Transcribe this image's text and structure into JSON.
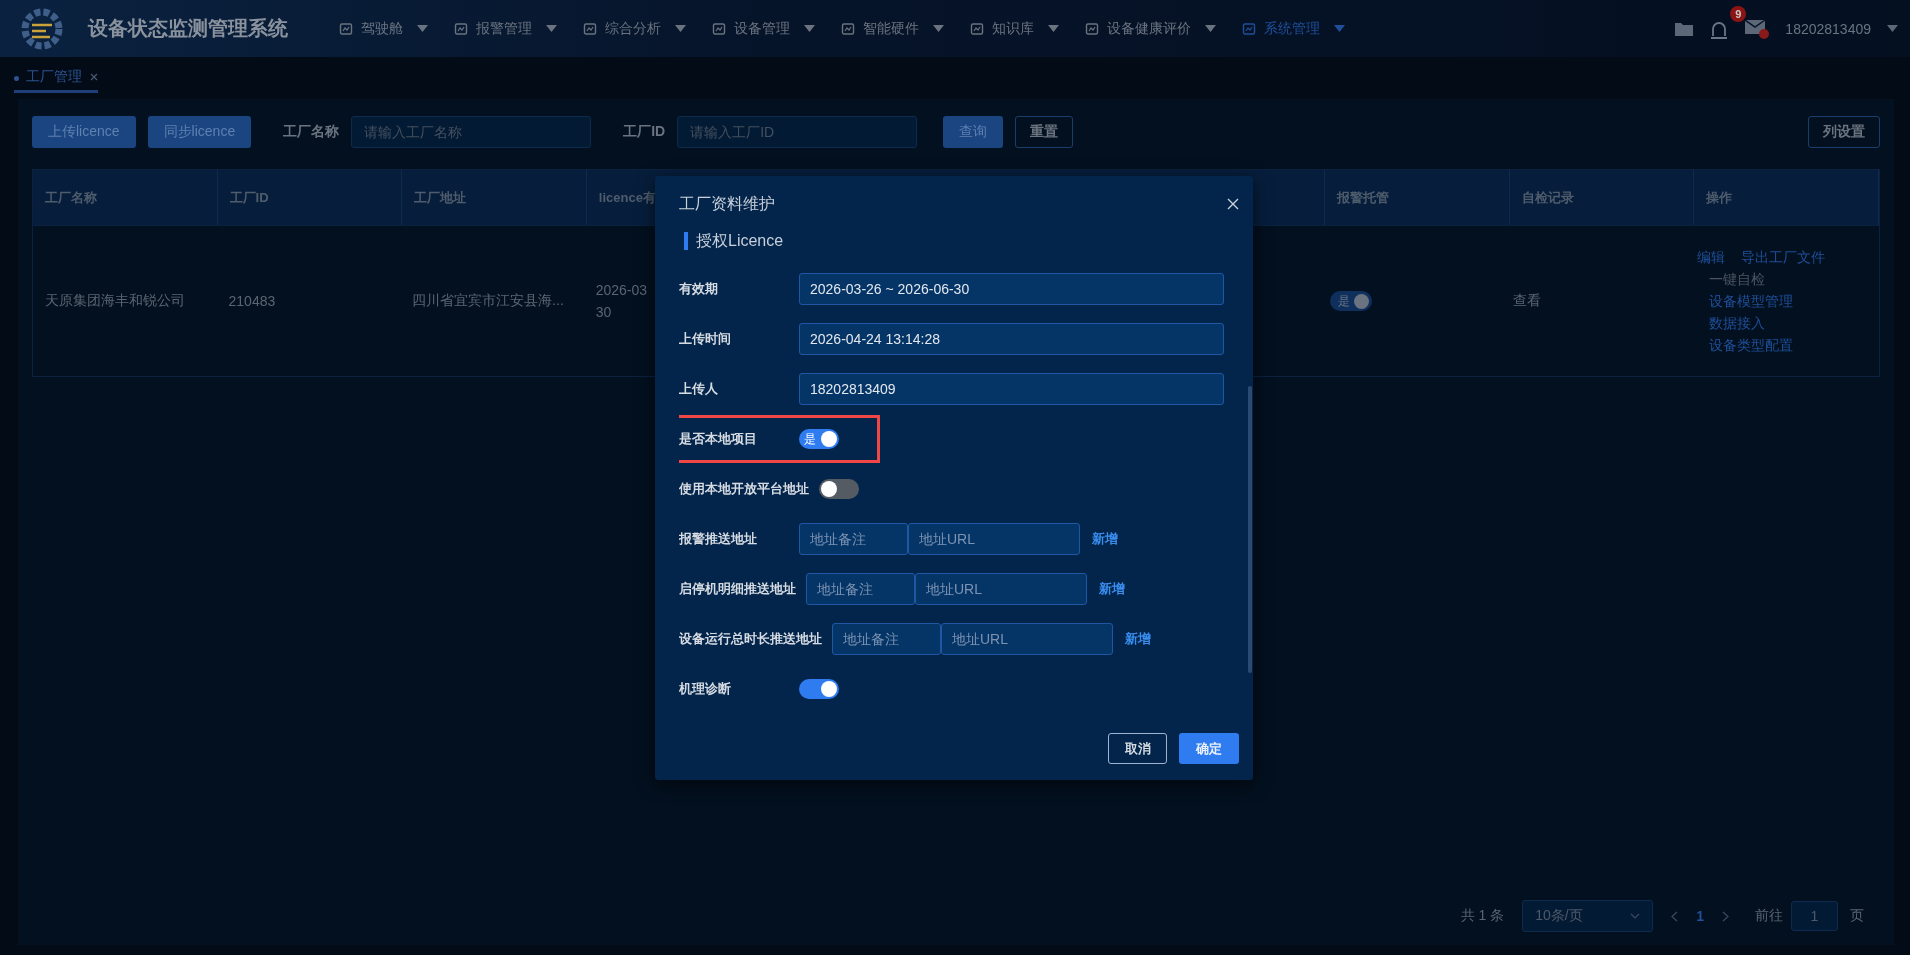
{
  "header": {
    "title": "设备状态监测管理系统",
    "nav": [
      {
        "label": "驾驶舱",
        "selected": false
      },
      {
        "label": "报警管理",
        "selected": false
      },
      {
        "label": "综合分析",
        "selected": false
      },
      {
        "label": "设备管理",
        "selected": false
      },
      {
        "label": "智能硬件",
        "selected": false
      },
      {
        "label": "知识库",
        "selected": false
      },
      {
        "label": "设备健康评价",
        "selected": false
      },
      {
        "label": "系统管理",
        "selected": true
      }
    ],
    "alarm_count": "9",
    "user": "18202813409"
  },
  "tabs": [
    {
      "label": "工厂管理",
      "selected": true
    }
  ],
  "toolbar": {
    "buttons": [
      "上传licence",
      "同步licence"
    ],
    "filters": [
      {
        "label": "工厂名称",
        "placeholder": "请输入工厂名称"
      },
      {
        "label": "工厂ID",
        "placeholder": "请输入工厂ID"
      }
    ],
    "query": "查询",
    "reset": "重置",
    "column_settings": "列设置"
  },
  "table": {
    "columns": [
      "工厂名称",
      "工厂ID",
      "工厂地址",
      "licence有",
      "报警托管",
      "自检记录",
      "操作"
    ],
    "rows": [
      {
        "cells": [
          {
            "kind": "text",
            "text": "天原集团海丰和锐公司"
          },
          {
            "kind": "text",
            "text": "210483"
          },
          {
            "kind": "text",
            "text": "四川省宜宾市江安县海..."
          },
          {
            "kind": "lines",
            "lines": [
              "2026-03",
              "30"
            ]
          },
          {
            "kind": "switch",
            "on": true,
            "text": "是"
          },
          {
            "kind": "link",
            "text": "查看"
          },
          {
            "kind": "actions",
            "actions": [
              {
                "label": "编辑",
                "disabled": false
              },
              {
                "label": "导出工厂文件",
                "disabled": false
              },
              {
                "label": "一键自检",
                "disabled": true
              },
              {
                "label": "设备模型管理",
                "disabled": false
              },
              {
                "label": "数据接入",
                "disabled": false
              },
              {
                "label": "设备类型配置",
                "disabled": false
              }
            ]
          }
        ]
      }
    ]
  },
  "pagination": {
    "total": "共 1 条",
    "page_size": "10条/页",
    "current": "1",
    "goto_label": "前往",
    "goto_value": "1",
    "page_unit": "页"
  },
  "dialog": {
    "title": "工厂资料维护",
    "section": "授权Licence",
    "rows": [
      {
        "kind": "input",
        "label": "有效期",
        "value": "2026-03-26 ~ 2026-06-30"
      },
      {
        "kind": "input",
        "label": "上传时间",
        "value": "2026-04-24 13:14:28"
      },
      {
        "kind": "input",
        "label": "上传人",
        "value": "18202813409"
      },
      {
        "kind": "switch",
        "label": "是否本地项目",
        "on": true,
        "text": "是",
        "highlighted": true
      },
      {
        "kind": "switch",
        "label": "使用本地开放平台地址",
        "on": false,
        "highlighted": false
      },
      {
        "kind": "address",
        "label": "报警推送地址",
        "note_placeholder": "地址备注",
        "url_placeholder": "地址URL",
        "add": "新增"
      },
      {
        "kind": "address",
        "label": "启停机明细推送地址",
        "note_placeholder": "地址备注",
        "url_placeholder": "地址URL",
        "add": "新增"
      },
      {
        "kind": "address",
        "label": "设备运行总时长推送地址",
        "note_placeholder": "地址备注",
        "url_placeholder": "地址URL",
        "add": "新增"
      },
      {
        "kind": "switch",
        "label": "机理诊断",
        "on": true,
        "highlighted": false
      }
    ],
    "cancel": "取消",
    "confirm": "确定"
  }
}
